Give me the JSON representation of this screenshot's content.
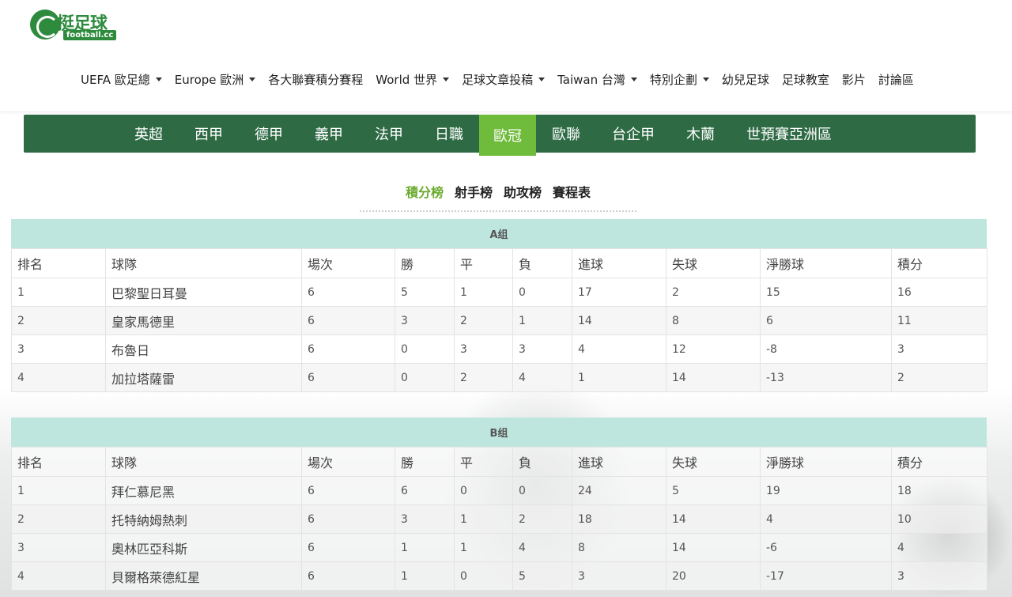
{
  "logo": {
    "main": "挺足球",
    "sub": "football.cc"
  },
  "topnav": [
    {
      "label": "UEFA 歐足總",
      "dropdown": true
    },
    {
      "label": "Europe 歐洲",
      "dropdown": true
    },
    {
      "label": "各大聯賽積分賽程",
      "dropdown": false
    },
    {
      "label": "World 世界",
      "dropdown": true
    },
    {
      "label": "足球文章投稿",
      "dropdown": true
    },
    {
      "label": "Taiwan 台灣",
      "dropdown": true
    },
    {
      "label": "特別企劃",
      "dropdown": true
    },
    {
      "label": "幼兒足球",
      "dropdown": false
    },
    {
      "label": "足球教室",
      "dropdown": false
    },
    {
      "label": "影片",
      "dropdown": false
    },
    {
      "label": "討論區",
      "dropdown": false
    }
  ],
  "leagues": [
    {
      "label": "英超",
      "active": false
    },
    {
      "label": "西甲",
      "active": false
    },
    {
      "label": "德甲",
      "active": false
    },
    {
      "label": "義甲",
      "active": false
    },
    {
      "label": "法甲",
      "active": false
    },
    {
      "label": "日職",
      "active": false
    },
    {
      "label": "歐冠",
      "active": true
    },
    {
      "label": "歐聯",
      "active": false
    },
    {
      "label": "台企甲",
      "active": false
    },
    {
      "label": "木蘭",
      "active": false
    },
    {
      "label": "世預賽亞洲區",
      "active": false
    }
  ],
  "subtabs": [
    {
      "label": "積分榜",
      "active": true
    },
    {
      "label": "射手榜",
      "active": false
    },
    {
      "label": "助攻榜",
      "active": false
    },
    {
      "label": "賽程表",
      "active": false
    }
  ],
  "columns": [
    "排名",
    "球隊",
    "場次",
    "勝",
    "平",
    "負",
    "進球",
    "失球",
    "淨勝球",
    "積分"
  ],
  "groups": [
    {
      "title": "A组",
      "rows": [
        [
          "1",
          "巴黎聖日耳曼",
          "6",
          "5",
          "1",
          "0",
          "17",
          "2",
          "15",
          "16"
        ],
        [
          "2",
          "皇家馬德里",
          "6",
          "3",
          "2",
          "1",
          "14",
          "8",
          "6",
          "11"
        ],
        [
          "3",
          "布魯日",
          "6",
          "0",
          "3",
          "3",
          "4",
          "12",
          "-8",
          "3"
        ],
        [
          "4",
          "加拉塔薩雷",
          "6",
          "0",
          "2",
          "4",
          "1",
          "14",
          "-13",
          "2"
        ]
      ]
    },
    {
      "title": "B组",
      "rows": [
        [
          "1",
          "拜仁慕尼黑",
          "6",
          "6",
          "0",
          "0",
          "24",
          "5",
          "19",
          "18"
        ],
        [
          "2",
          "托特納姆熱刺",
          "6",
          "3",
          "1",
          "2",
          "18",
          "14",
          "4",
          "10"
        ],
        [
          "3",
          "奧林匹亞科斯",
          "6",
          "1",
          "1",
          "4",
          "8",
          "14",
          "-6",
          "4"
        ],
        [
          "4",
          "貝爾格萊德紅星",
          "6",
          "1",
          "0",
          "5",
          "3",
          "20",
          "-17",
          "3"
        ]
      ]
    }
  ],
  "colors": {
    "brand_green": "#2e6b45",
    "active_tab": "#6fbb3b",
    "group_header": "#bfe6de",
    "subtab_active": "#6aaa2e"
  }
}
